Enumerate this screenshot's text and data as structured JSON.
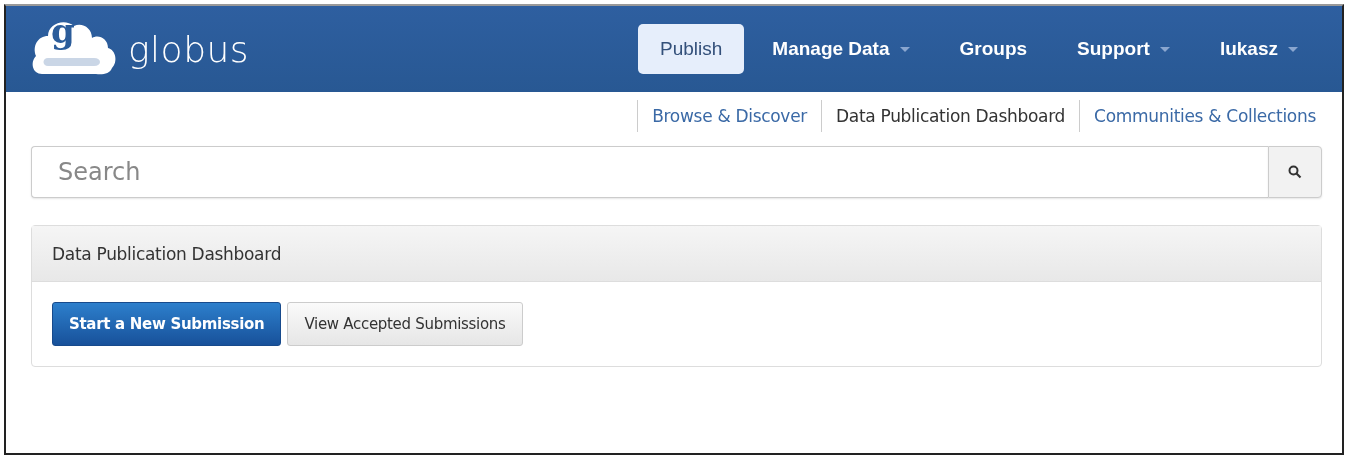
{
  "logo": {
    "mark": "g",
    "text": "globus"
  },
  "nav": [
    {
      "label": "Publish",
      "selected": true,
      "dropdown": false
    },
    {
      "label": "Manage Data",
      "selected": false,
      "dropdown": true
    },
    {
      "label": "Groups",
      "selected": false,
      "dropdown": false
    },
    {
      "label": "Support",
      "selected": false,
      "dropdown": true
    },
    {
      "label": "lukasz",
      "selected": false,
      "dropdown": true
    }
  ],
  "subnav": [
    {
      "label": "Browse & Discover",
      "selected": false
    },
    {
      "label": "Data Publication Dashboard",
      "selected": true
    },
    {
      "label": "Communities & Collections",
      "selected": false
    }
  ],
  "search": {
    "placeholder": "Search"
  },
  "panel": {
    "title": "Data Publication Dashboard",
    "buttons": [
      {
        "label": "Start a New Submission",
        "kind": "primary"
      },
      {
        "label": "View Accepted Submissions",
        "kind": "default"
      }
    ]
  }
}
